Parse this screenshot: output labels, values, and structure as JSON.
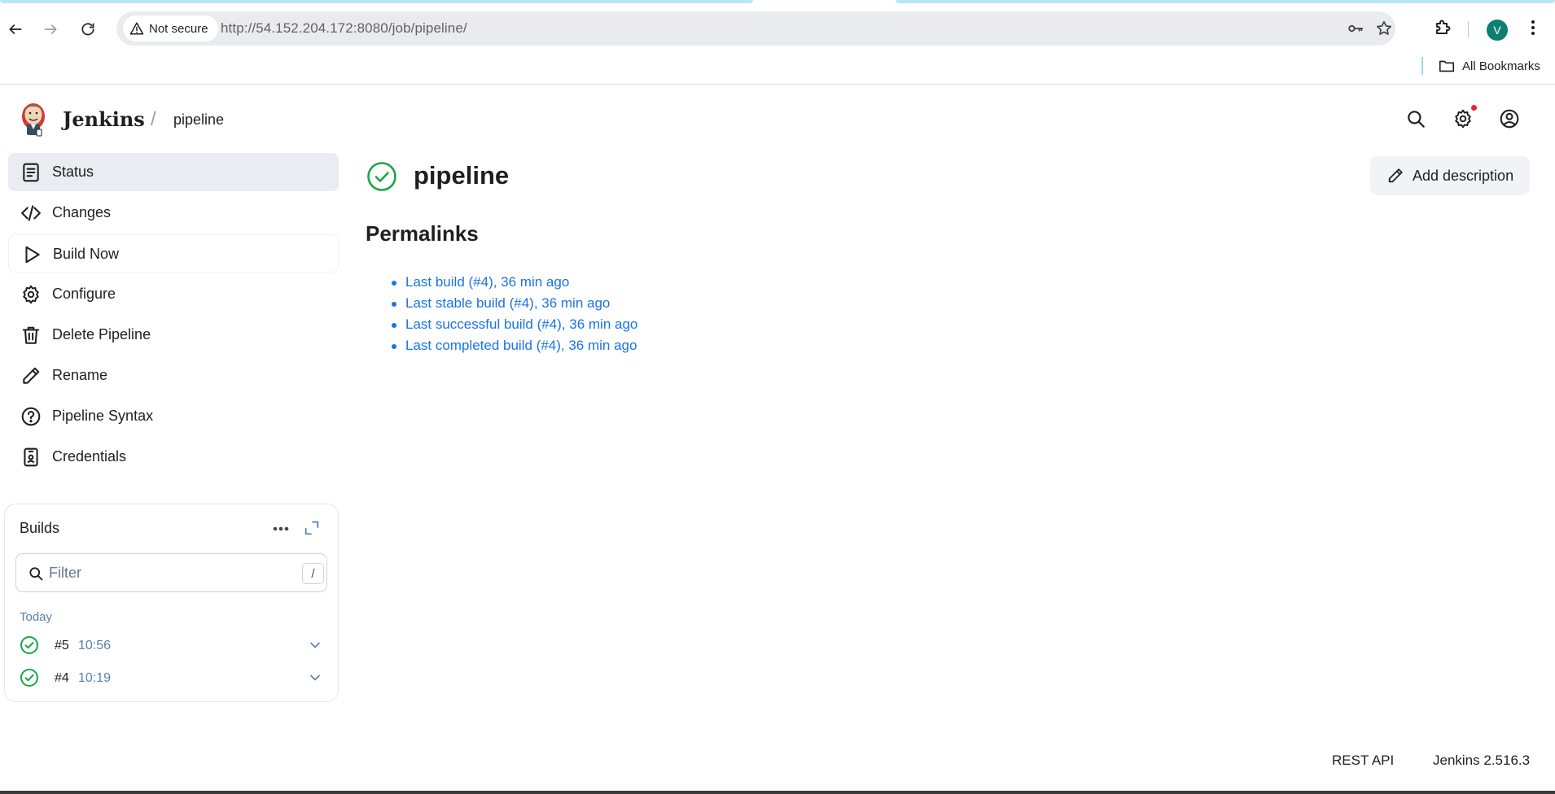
{
  "browser": {
    "security_label": "Not secure",
    "url": "http://54.152.204.172:8080/job/pipeline/",
    "profile_initial": "V",
    "bookmarks_label": "All Bookmarks"
  },
  "header": {
    "brand": "Jenkins",
    "breadcrumb": "pipeline"
  },
  "sidebar": {
    "items": [
      {
        "label": "Status",
        "icon": "status-icon"
      },
      {
        "label": "Changes",
        "icon": "code-icon"
      },
      {
        "label": "Build Now",
        "icon": "play-icon"
      },
      {
        "label": "Configure",
        "icon": "gear-icon"
      },
      {
        "label": "Delete Pipeline",
        "icon": "trash-icon"
      },
      {
        "label": "Rename",
        "icon": "pencil-icon"
      },
      {
        "label": "Pipeline Syntax",
        "icon": "help-icon"
      },
      {
        "label": "Credentials",
        "icon": "credentials-icon"
      }
    ]
  },
  "builds": {
    "title": "Builds",
    "filter_placeholder": "Filter",
    "filter_shortcut": "/",
    "group_label": "Today",
    "rows": [
      {
        "number": "#5",
        "time": "10:56",
        "status": "success"
      },
      {
        "number": "#4",
        "time": "10:19",
        "status": "success"
      }
    ]
  },
  "main": {
    "title": "pipeline",
    "add_description": "Add description",
    "permalinks_title": "Permalinks",
    "permalinks": [
      "Last build (#4), 36 min ago",
      "Last stable build (#4), 36 min ago",
      "Last successful build (#4), 36 min ago",
      "Last completed build (#4), 36 min ago"
    ]
  },
  "footer": {
    "rest_api": "REST API",
    "version": "Jenkins 2.516.3"
  },
  "colors": {
    "success": "#1ea446",
    "link": "#1a73e8",
    "active_bg": "#e9ecf1"
  }
}
